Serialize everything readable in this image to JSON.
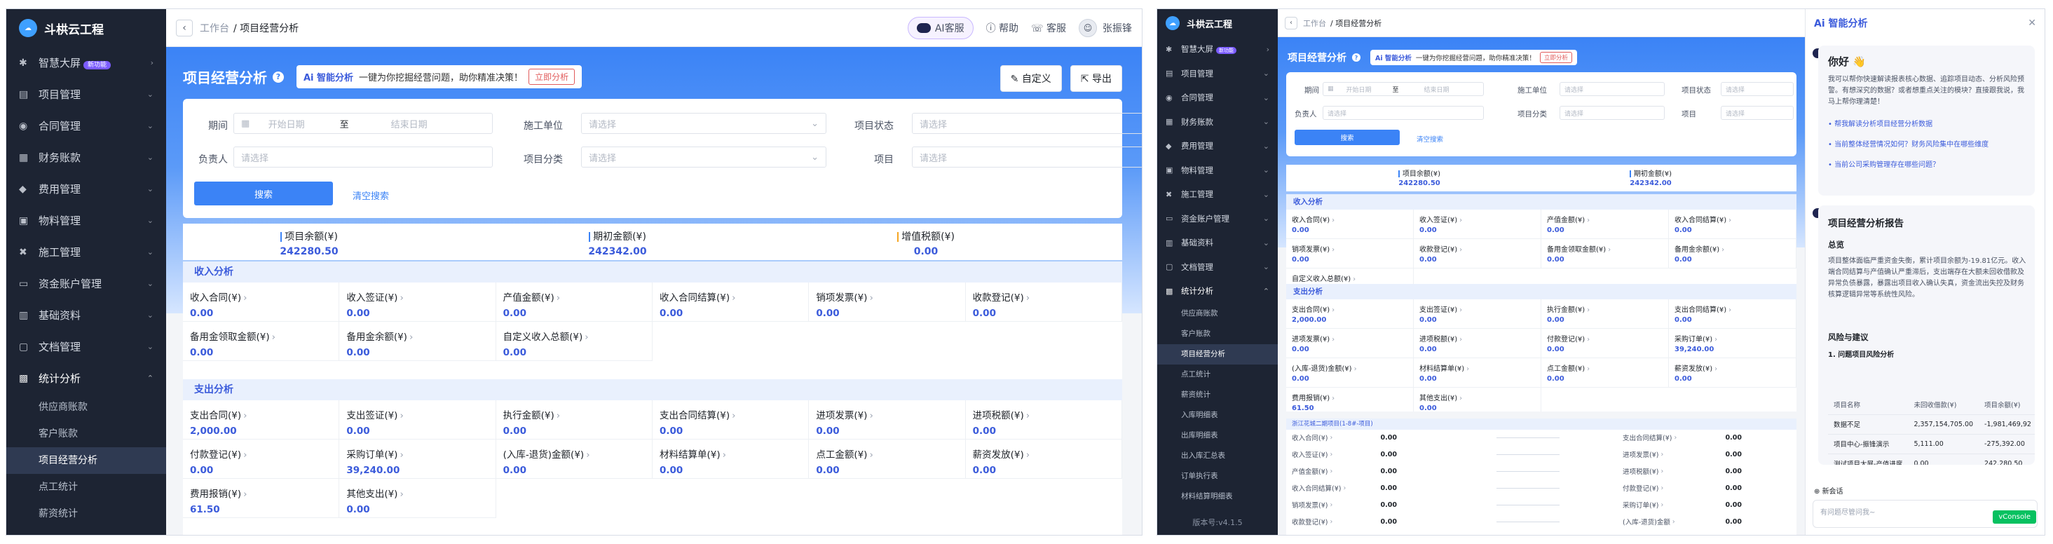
{
  "app": {
    "name": "斗栱云工程",
    "version": "版本号:v4.1.5"
  },
  "sidebar": {
    "items": [
      {
        "label": "智慧大屏",
        "icon": "dashboard-icon",
        "badge": "新功能"
      },
      {
        "label": "项目管理",
        "icon": "project-icon"
      },
      {
        "label": "合同管理",
        "icon": "contract-icon"
      },
      {
        "label": "财务账款",
        "icon": "finance-icon"
      },
      {
        "label": "费用管理",
        "icon": "expense-icon"
      },
      {
        "label": "物料管理",
        "icon": "material-icon"
      },
      {
        "label": "施工管理",
        "icon": "construction-icon"
      },
      {
        "label": "资金账户管理",
        "icon": "account-icon"
      },
      {
        "label": "基础资料",
        "icon": "base-data-icon"
      },
      {
        "label": "文档管理",
        "icon": "document-icon"
      },
      {
        "label": "统计分析",
        "icon": "statistics-icon"
      }
    ],
    "sub_items_1": [
      "供应商账款",
      "客户账款",
      "项目经营分析",
      "点工统计",
      "薪资统计"
    ],
    "sub_items_2": [
      "供应商账款",
      "客户账款",
      "项目经营分析",
      "点工统计",
      "薪资统计",
      "入库明细表",
      "出库明细表",
      "出入库汇总表",
      "订单执行表",
      "材料结算明细表"
    ]
  },
  "topbar": {
    "crumb_parent": "工作台",
    "crumb_current": "/ 项目经营分析",
    "ai_service": "AI客服",
    "help": "帮助",
    "service": "客服",
    "user": "张振锋"
  },
  "hero": {
    "title": "项目经营分析",
    "ai_tag": "Ai 智能分析",
    "ai_text": "一键为你挖掘经营问题，助你精准决策！",
    "ai_button": "立即分析",
    "custom_button": "自定义",
    "export_button": "导出"
  },
  "filter": {
    "period_label": "期间",
    "start_placeholder": "开始日期",
    "to": "至",
    "end_placeholder": "结束日期",
    "unit_label": "施工单位",
    "status_label": "项目状态",
    "owner_label": "负责人",
    "category_label": "项目分类",
    "project_label": "项目",
    "select_placeholder": "请选择",
    "search": "搜索",
    "clear": "清空搜索"
  },
  "summary": [
    {
      "label": "项目余额(¥)",
      "value": "242280.50",
      "color": "#3b83f6"
    },
    {
      "label": "期初金额(¥)",
      "value": "242342.00",
      "color": "#3b83f6"
    },
    {
      "label": "增值税额(¥)",
      "value": "0.00",
      "color": "#f5a623"
    }
  ],
  "income": {
    "title": "收入分析",
    "cells": [
      {
        "label": "收入合同(¥)",
        "value": "0.00"
      },
      {
        "label": "收入签证(¥)",
        "value": "0.00"
      },
      {
        "label": "产值金额(¥)",
        "value": "0.00"
      },
      {
        "label": "收入合同结算(¥)",
        "value": "0.00"
      },
      {
        "label": "销项发票(¥)",
        "value": "0.00"
      },
      {
        "label": "收款登记(¥)",
        "value": "0.00"
      },
      {
        "label": "备用金领取金额(¥)",
        "value": "0.00"
      },
      {
        "label": "备用金余额(¥)",
        "value": "0.00"
      },
      {
        "label": "自定义收入总额(¥)",
        "value": "0.00"
      }
    ]
  },
  "expense": {
    "title": "支出分析",
    "cells": [
      {
        "label": "支出合同(¥)",
        "value": "2,000.00"
      },
      {
        "label": "支出签证(¥)",
        "value": "0.00"
      },
      {
        "label": "执行金额(¥)",
        "value": "0.00"
      },
      {
        "label": "支出合同结算(¥)",
        "value": "0.00"
      },
      {
        "label": "进项发票(¥)",
        "value": "0.00"
      },
      {
        "label": "进项税额(¥)",
        "value": "0.00"
      },
      {
        "label": "付款登记(¥)",
        "value": "0.00"
      },
      {
        "label": "采购订单(¥)",
        "value": "39,240.00"
      },
      {
        "label": "(入库-退货)金额(¥)",
        "value": "0.00"
      },
      {
        "label": "材料结算单(¥)",
        "value": "0.00"
      },
      {
        "label": "点工金额(¥)",
        "value": "0.00"
      },
      {
        "label": "薪资发放(¥)",
        "value": "0.00"
      },
      {
        "label": "费用报销(¥)",
        "value": "61.50"
      },
      {
        "label": "其他支出(¥)",
        "value": "0.00"
      }
    ]
  },
  "project": {
    "title": "浙江花城二期项目(1-8#-项目)",
    "left": [
      {
        "label": "收入合同(¥)",
        "value": "0.00"
      },
      {
        "label": "收入签证(¥)",
        "value": "0.00"
      },
      {
        "label": "产值金额(¥)",
        "value": "0.00"
      },
      {
        "label": "收入合同结算(¥)",
        "value": "0.00"
      },
      {
        "label": "销项发票(¥)",
        "value": "0.00"
      },
      {
        "label": "收款登记(¥)",
        "value": "0.00"
      }
    ],
    "right": [
      {
        "label": "支出合同结算(¥)",
        "value": "0.00"
      },
      {
        "label": "进项发票(¥)",
        "value": "0.00"
      },
      {
        "label": "进项税额(¥)",
        "value": "0.00"
      },
      {
        "label": "付款登记(¥)",
        "value": "0.00"
      },
      {
        "label": "采购订单(¥)",
        "value": "0.00"
      },
      {
        "label": "(入库-退货)金额",
        "value": "0.00"
      }
    ]
  },
  "ai_panel": {
    "title": "Ai 智能分析",
    "greeting": "你好 👋",
    "intro": "我可以帮你快速解读报表核心数据、追踪项目动态、分析风险预警。有想深究的数据？或者想重点关注的模块？直接跟我说，我马上帮你理清楚！",
    "links": [
      "帮我解读分析项目经营分析数据",
      "当前整体经营情况如何？财务风险集中在哪些维度",
      "当前公司采购管理存在哪些问题？"
    ],
    "report_title": "项目经营分析报告",
    "overview_title": "总览",
    "overview": "项目整体面临严重资金失衡，累计项目余额为-19.81亿元。收入端合同结算与产值确认严重滞后，支出端存在大额未回收借款及异常负债暴露，暴露出项目收入确认失真，资金流出失控及财务核算逻辑异常等系统性风险。",
    "risk_title": "风险与建议",
    "risk_sub": "1. 问题项目风险分析",
    "table_headers": [
      "项目名称",
      "未回收借款(¥)",
      "项目余额(¥)"
    ],
    "table_rows": [
      [
        "数据不足",
        "2,357,154,705.00",
        "-1,981,469,92"
      ],
      [
        "项目中心-振锋演示",
        "5,111.00",
        "-275,392.00"
      ],
      [
        "测试项目大屏-产值进度",
        "0.00",
        "242,280.50"
      ]
    ],
    "new_chat": "新会话",
    "input_placeholder": "有问题尽管问我~",
    "vconsole": "vConsole"
  }
}
